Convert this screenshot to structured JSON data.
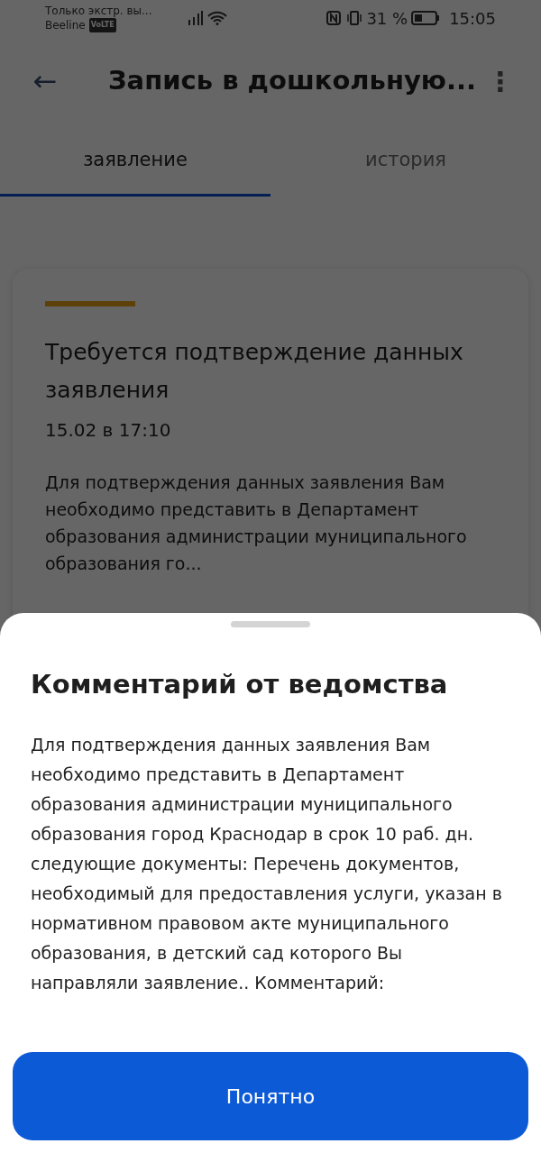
{
  "status_bar": {
    "operator_line1": "Только экстр. вы...",
    "operator_line2": "Beeline",
    "volte": "VoLTE",
    "battery": "31 %",
    "time": "15:05"
  },
  "header": {
    "back": "←",
    "title": "Запись в дошкольную...",
    "menu": "⋮"
  },
  "tabs": [
    {
      "label": "заявление",
      "selected": true
    },
    {
      "label": "история",
      "selected": false
    }
  ],
  "card": {
    "title": "Требуется подтверждение данных заявления",
    "date": "15.02 в 17:10",
    "text": "Для подтверждения данных заявления Вам необходимо представить в Департамент образования администрации муниципального образования го..."
  },
  "sheet": {
    "title": "Комментарий от ведомства",
    "text": "Для подтверждения данных заявления Вам необходимо представить в Департамент образования администрации муниципального образования город Краснодар в срок 10 раб. дн. следующие документы: Перечень документов, необходимый для предоставления услуги, указан в нормативном правовом акте муниципального образования, в детский сад которого Вы направляли заявление.. Комментарий:",
    "button": "Понятно"
  }
}
